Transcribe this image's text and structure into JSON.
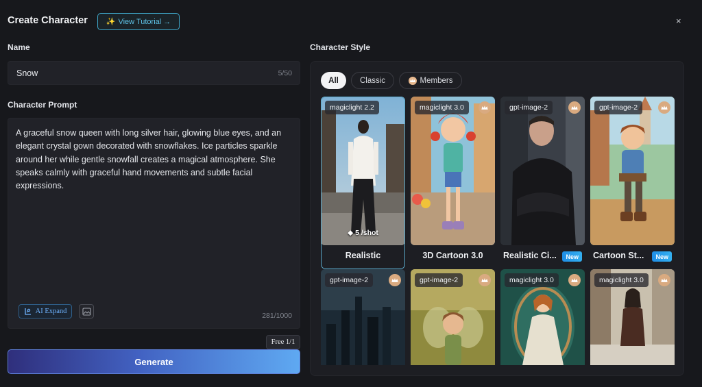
{
  "header": {
    "title": "Create Character",
    "tutorial_label": "View Tutorial →",
    "close_symbol": "×"
  },
  "name_section": {
    "label": "Name",
    "value": "Snow",
    "count": "5/50"
  },
  "prompt_section": {
    "label": "Character Prompt",
    "value": "A graceful snow queen with long silver hair, glowing blue eyes, and an elegant crystal gown decorated with snowflakes. Ice particles sparkle around her while gentle snowfall creates a magical atmosphere. She speaks calmly with graceful hand movements and subtle facial expressions.",
    "ai_expand_label": "AI Expand",
    "count": "281/1000"
  },
  "free_badge": "Free 1/1",
  "generate_label": "Generate",
  "style_section": {
    "label": "Character Style",
    "filters": [
      {
        "label": "All",
        "selected": true
      },
      {
        "label": "Classic",
        "selected": false
      },
      {
        "label": "Members",
        "selected": false
      }
    ],
    "cards": [
      {
        "model": "magiclight 2.2",
        "name": "Realistic",
        "cost": "5 /shot",
        "members": false,
        "new": false,
        "selected": true
      },
      {
        "model": "magiclight 3.0",
        "name": "3D Cartoon 3.0",
        "members": true,
        "new": false
      },
      {
        "model": "gpt-image-2",
        "name": "Realistic Ci...",
        "members": true,
        "new": true,
        "new_label": "New"
      },
      {
        "model": "gpt-image-2",
        "name": "Cartoon St...",
        "members": true,
        "new": true,
        "new_label": "New"
      },
      {
        "model": "gpt-image-2",
        "members": true
      },
      {
        "model": "gpt-image-2",
        "members": true
      },
      {
        "model": "magiclight 3.0",
        "members": true
      },
      {
        "model": "magiclight 3.0",
        "members": true
      }
    ]
  },
  "icons": {
    "tutorial": "sparkle-icon",
    "close": "close-icon",
    "ai_expand": "ai-expand-icon",
    "image_upload": "image-icon",
    "members": "crown-icon",
    "cost": "diamond-icon"
  },
  "colors": {
    "background": "#17181c",
    "panel": "#1d1e23",
    "accent": "#3fa7c9",
    "generate_start": "#2f2f7c",
    "generate_end": "#5fa9f2",
    "new_badge": "#1f8ee6",
    "crown": "#d9aa80"
  }
}
